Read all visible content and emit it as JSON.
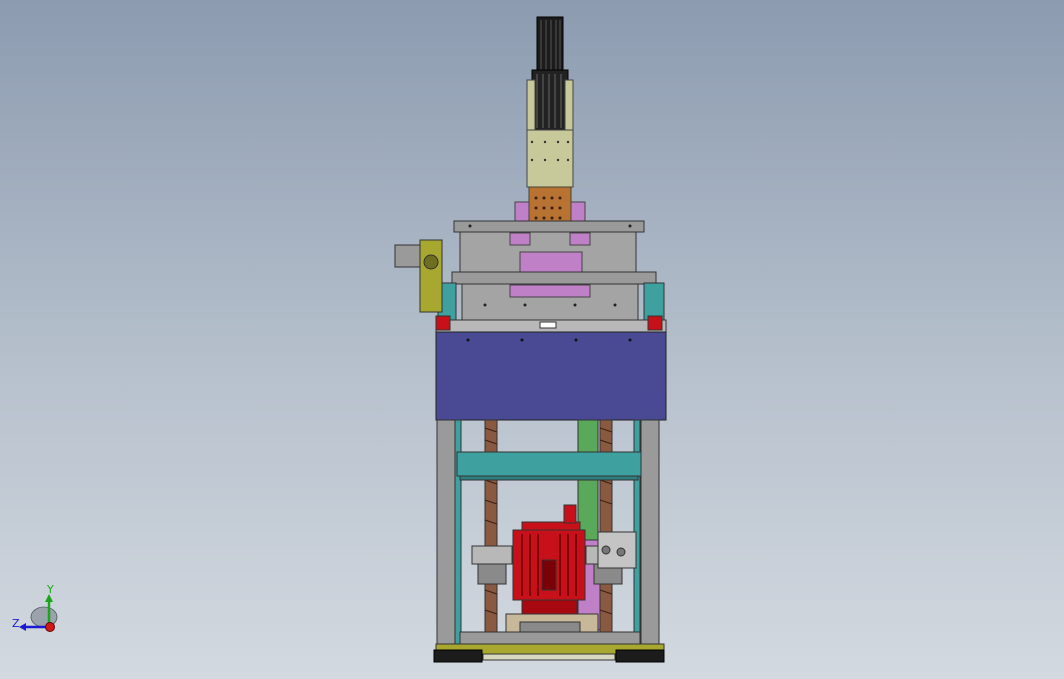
{
  "viewport": {
    "background_top": "#8c9bb0",
    "background_bottom": "#d3d9e0"
  },
  "triad": {
    "y_label": "Y",
    "z_label": "Z",
    "y_color": "#1aa61a",
    "z_color": "#1a1ad0",
    "x_color": "#d01a1a"
  },
  "model": {
    "parts": {
      "motor_color": "#c8101a",
      "guard_panel_color": "#4a4a94",
      "crossbeam_color": "#3fa0a0",
      "upper_column_color": "#c7c99a",
      "coupling_color": "#b87333",
      "ball_screw_color": "#8a5a40",
      "guide_rod_color": "#5aa85a",
      "plate_color": "#9a9a9a",
      "bracket_color": "#a8a830",
      "accent_pink": "#c080c8"
    }
  }
}
